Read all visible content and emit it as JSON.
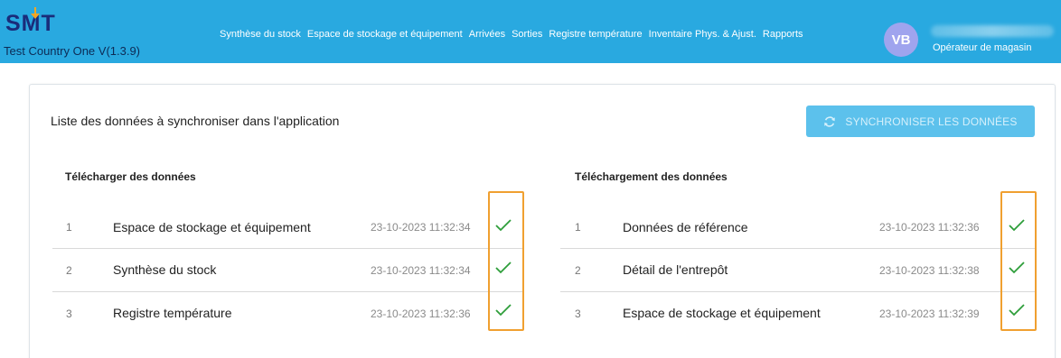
{
  "app": {
    "logo_text": "SMT",
    "country": "Test Country One V(1.3.9)"
  },
  "nav": [
    "Synthèse du stock",
    "Espace de stockage et équipement",
    "Arrivées",
    "Sorties",
    "Registre température",
    "Inventaire Phys. & Ajust.",
    "Rapports"
  ],
  "user": {
    "initials": "VB",
    "role": "Opérateur de magasin"
  },
  "main": {
    "title": "Liste des données à synchroniser dans l'application",
    "sync_button": "SYNCHRONISER LES DONNÉES"
  },
  "download": {
    "title": "Télécharger des données",
    "rows": [
      {
        "idx": "1",
        "name": "Espace de stockage et équipement",
        "date": "23-10-2023 11:32:34"
      },
      {
        "idx": "2",
        "name": "Synthèse du stock",
        "date": "23-10-2023 11:32:34"
      },
      {
        "idx": "3",
        "name": "Registre température",
        "date": "23-10-2023 11:32:36"
      }
    ]
  },
  "upload": {
    "title": "Téléchargement des données",
    "rows": [
      {
        "idx": "1",
        "name": "Données de référence",
        "date": "23-10-2023 11:32:36"
      },
      {
        "idx": "2",
        "name": "Détail de l'entrepôt",
        "date": "23-10-2023 11:32:38"
      },
      {
        "idx": "3",
        "name": "Espace de stockage et équipement",
        "date": "23-10-2023 11:32:39"
      }
    ]
  },
  "colors": {
    "header": "#29a9e0",
    "button": "#5cc1ec",
    "check": "#2e9e3a",
    "highlight": "#f0a030"
  },
  "icons": {
    "sync": "sync-icon",
    "check": "check-icon"
  }
}
